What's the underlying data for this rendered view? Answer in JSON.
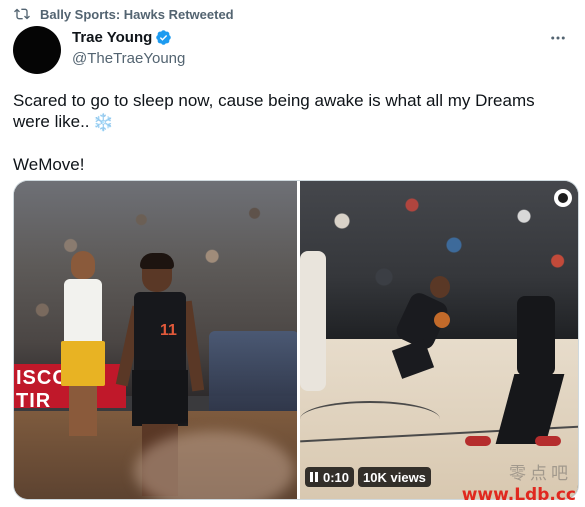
{
  "retweet": {
    "text": "Bally Sports: Hawks Retweeted",
    "icon": "retweet-icon"
  },
  "author": {
    "name": "Trae Young",
    "handle": "@TheTraeYoung",
    "verified": true,
    "verified_color": "#1d9bf0"
  },
  "tweet": {
    "line1": "Scared to go to sleep now, cause being awake is what all my Dreams were like..",
    "emoji": "❄️",
    "line2": "WeMove!"
  },
  "media": {
    "photo": {
      "banner_text": "ISCO",
      "banner_text2": "TIR",
      "jersey_number": "11"
    },
    "video": {
      "time": "0:10",
      "views": "10K views"
    }
  },
  "watermark": {
    "cn": "零点吧",
    "url": "www.Ldb.cc"
  },
  "colors": {
    "secondary_text": "#536471",
    "primary_text": "#0f1419",
    "watermark_red": "#e0281f"
  }
}
